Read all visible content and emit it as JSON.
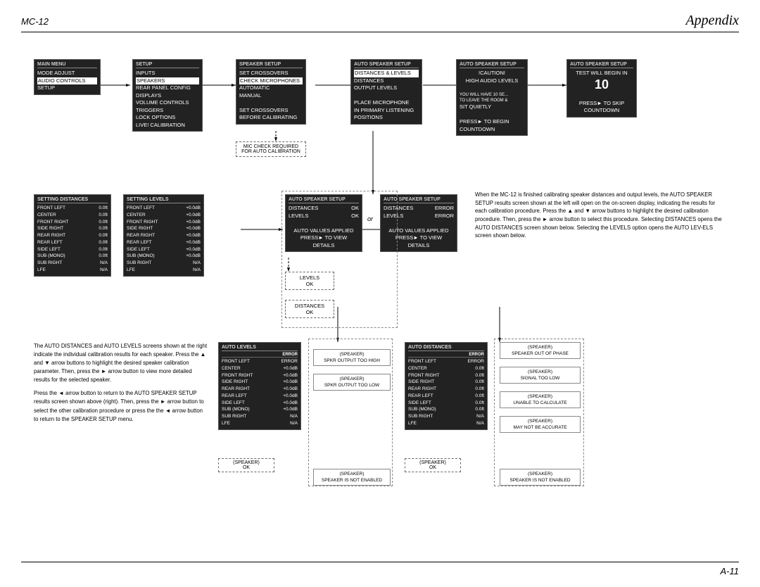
{
  "header": {
    "left": "MC-12",
    "right": "Appendix"
  },
  "footer": "A-11",
  "top_row": {
    "mainmenu": {
      "title": "MAIN MENU",
      "items": [
        "MODE ADJUST",
        "AUDIO CONTROLS",
        "SETUP"
      ],
      "selected": "AUDIO CONTROLS"
    },
    "setup": {
      "title": "SETUP",
      "items": [
        "INPUTS",
        "SPEAKERS",
        "REAR PANEL CONFIG",
        "DISPLAYS",
        "VOLUME CONTROLS",
        "TRIGGERS",
        "LOCK OPTIONS",
        "LIVE! CALIBRATION"
      ],
      "selected": "SPEAKERS"
    },
    "speaker_setup": {
      "title": "SPEAKER SETUP",
      "items": [
        "SET CROSSOVERS",
        "CHECK MICROPHONES",
        "AUTOMATIC",
        "MANUAL",
        "",
        "SET CROSSOVERS",
        "BEFORE CALIBRATING"
      ],
      "selected": "CHECK MICROPHONES"
    },
    "auto_speaker_1": {
      "title": "AUTO SPEAKER SETUP",
      "items": [
        "DISTANCES & LEVELS",
        "DISTANCES",
        "OUTPUT LEVELS",
        "",
        "PLACE MICROPHONE",
        "IN PRIMARY LISTENING",
        "POSITIONS"
      ],
      "selected": "DISTANCES & LEVELS"
    },
    "auto_speaker_2": {
      "title": "AUTO SPEAKER SETUP",
      "items": [
        "!CAUTION!",
        "HIGH AUDIO LEVELS",
        "",
        "YOU WILL HAVE 10 SE...",
        "TO LEAVE THE ROOM &",
        "SIT QUIETLY",
        "",
        "PRESS► TO BEGIN",
        "COUNTDOWN"
      ],
      "selected": ""
    },
    "auto_speaker_3": {
      "title": "AUTO SPEAKER SETUP",
      "items": [
        "TEST WILL BEGIN IN",
        "10",
        "",
        "PRESS► TO SKIP",
        "COUNTDOWN"
      ],
      "selected": ""
    }
  },
  "mic_note": {
    "line1": "MIC CHECK REQUIRED",
    "line2": "FOR AUTO CALIBRATION"
  },
  "middle_row": {
    "setting_distances": {
      "title": "SETTING DISTANCES",
      "rows": [
        {
          "label": "FRONT LEFT",
          "value": "0.0ft"
        },
        {
          "label": "CENTER",
          "value": "0.0ft"
        },
        {
          "label": "FRONT RIGHT",
          "value": "0.0ft"
        },
        {
          "label": "SIDE RIGHT",
          "value": "0.0ft"
        },
        {
          "label": "REAR RIGHT",
          "value": "0.0ft"
        },
        {
          "label": "REAR LEFT",
          "value": "0.0ft"
        },
        {
          "label": "SIDE LEFT",
          "value": "0.0ft"
        },
        {
          "label": "SUB (MONO)",
          "value": "0.0ft"
        },
        {
          "label": "SUB RIGHT",
          "value": "N/A"
        },
        {
          "label": "LFE",
          "value": "N/A"
        }
      ]
    },
    "setting_levels": {
      "title": "SETTING LEVELS",
      "rows": [
        {
          "label": "FRONT LEFT",
          "value": "+0.0dB"
        },
        {
          "label": "CENTER",
          "value": "+0.0dB"
        },
        {
          "label": "FRONT RIGHT",
          "value": "+0.0dB"
        },
        {
          "label": "SIDE RIGHT",
          "value": "+0.0dB"
        },
        {
          "label": "REAR RIGHT",
          "value": "+0.0dB"
        },
        {
          "label": "REAR LEFT",
          "value": "+0.0dB"
        },
        {
          "label": "SIDE LEFT",
          "value": "+0.0dB"
        },
        {
          "label": "SUB (MONO)",
          "value": "+0.0dB"
        },
        {
          "label": "SUB RIGHT",
          "value": "N/A"
        },
        {
          "label": "LFE",
          "value": "N/A"
        }
      ]
    },
    "auto_ok": {
      "title": "AUTO SPEAKER SETUP",
      "distances": "DISTANCES  OK",
      "levels": "LEVELS    OK",
      "auto_values": "AUTO VALUES APPLIED",
      "press": "PRESS► TO VIEW",
      "details": "DETAILS"
    },
    "auto_error": {
      "title": "AUTO SPEAKER SETUP",
      "distances": "DISTANCES  ERROR",
      "levels": "LEVELS    ERROR",
      "auto_values": "AUTO VALUES APPLIED",
      "press": "PRESS► TO VIEW",
      "details": "DETAILS"
    },
    "levels_popup": {
      "label": "LEVELS",
      "ok": "OK"
    },
    "distances_popup": {
      "label": "DISTANCES",
      "ok": "OK"
    }
  },
  "bottom_row": {
    "auto_levels": {
      "title": "AUTO LEVELS",
      "headers": [
        "",
        "ERROR"
      ],
      "rows": [
        {
          "label": "FRONT LEFT",
          "value": "ERROR"
        },
        {
          "label": "CENTER",
          "value": "+0.0dB"
        },
        {
          "label": "FRONT RIGHT",
          "value": "+0.0dB"
        },
        {
          "label": "SIDE RIGHT",
          "value": "+0.0dB"
        },
        {
          "label": "REAR RIGHT",
          "value": "+0.0dB"
        },
        {
          "label": "REAR LEFT",
          "value": "+0.0dB"
        },
        {
          "label": "SIDE LEFT",
          "value": "+0.0dB"
        },
        {
          "label": "SUB (MONO)",
          "value": "+0.0dB"
        },
        {
          "label": "SUB RIGHT",
          "value": "N/A"
        },
        {
          "label": "LFE",
          "value": "N/A"
        }
      ],
      "speaker_ok": "(SPEAKER) OK"
    },
    "speaker_too_high": "(SPEAKER)\nSPKR OUTPUT TOO HIGH",
    "speaker_too_low": "(SPEAKER)\nSPKR OUTPUT TOO LOW",
    "speaker_not_enabled_1": "(SPEAKER)\nSPEAKER IS NOT ENABLED",
    "auto_distances": {
      "title": "AUTO DISTANCES",
      "headers": [
        "",
        "ERROR"
      ],
      "rows": [
        {
          "label": "FRONT LEFT",
          "value": "ERROR"
        },
        {
          "label": "CENTER",
          "value": "0.0ft"
        },
        {
          "label": "FRONT RIGHT",
          "value": "0.0ft"
        },
        {
          "label": "SIDE RIGHT",
          "value": "0.0ft"
        },
        {
          "label": "REAR RIGHT",
          "value": "0.0ft"
        },
        {
          "label": "REAR LEFT",
          "value": "0.0ft"
        },
        {
          "label": "SIDE LEFT",
          "value": "0.0ft"
        },
        {
          "label": "SUB (MONO)",
          "value": "0.0ft"
        },
        {
          "label": "SUB RIGHT",
          "value": "N/A"
        },
        {
          "label": "LFE",
          "value": "N/A"
        }
      ],
      "speaker_ok": "(SPEAKER) OK"
    },
    "speaker_out_of_phase": "(SPEAKER)\nSPEAKER OUT OF PHASE",
    "signal_too_low": "(SPEAKER)\nSIGNAL TOO LOW",
    "unable_to_calculate": "(SPEAKER)\nUNABLE TO CALCULATE",
    "may_not_be_accurate": "(SPEAKER)\nMAY NOT BE ACCURATE",
    "speaker_not_enabled_2": "(SPEAKER)\nSPEAKER IS NOT ENABLED"
  },
  "prose1": {
    "text": "When the MC-12 is finished calibrating speaker distances and output levels, the AUTO SPEAKER SETUP results screen shown at the left will open on the on-screen display, indicating the results for each calibration procedure. Press the ▲ and ▼ arrow buttons to highlight the desired calibration procedure. Then, press the ► arrow button to select this procedure. Selecting DISTANCES opens the AUTO DISTANCES screen shown below. Selecting the LEVELS option opens the AUTO LEV-ELS screen shown below."
  },
  "prose2": {
    "text": "The AUTO DISTANCES and AUTO LEVELS screens shown at the right indicate the individual calibration results for each speaker. Press the ▲ and ▼ arrow buttons to highlight the desired speaker calibration parameter. Then, press the ► arrow button to view more detailed results for the selected speaker.\n\nPress the ◄ arrow button to return to the AUTO SPEAKER SETUP results screen shown above (right). Then, press the ► arrow button to select the other calibration procedure or press the the ◄ arrow button to return to the SPEAKER SETUP menu."
  }
}
